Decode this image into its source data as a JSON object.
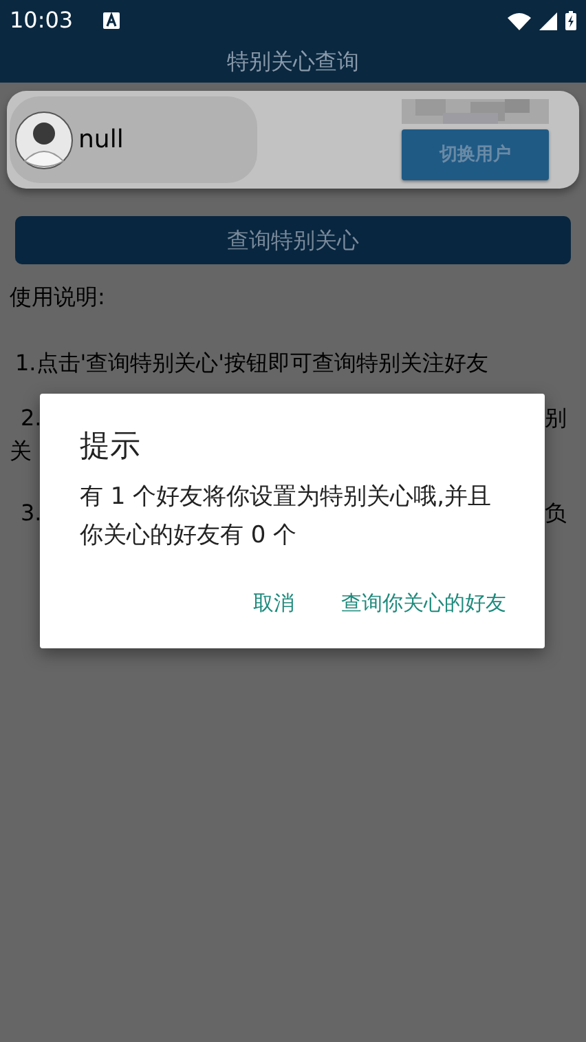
{
  "status_bar": {
    "time": "10:03"
  },
  "app_bar": {
    "title": "特别关心查询"
  },
  "user_card": {
    "name": "null",
    "switch_button": "切换用户"
  },
  "query_button": "查询特别关心",
  "instructions": {
    "heading": "使用说明:",
    "item_1": "1.点击'查询特别关心'按钮即可查询特别关注好友",
    "item_2_fragments": [
      {
        "kind": "start",
        "text": "2."
      },
      {
        "kind": "end",
        "text": "别"
      },
      {
        "kind": "wrap",
        "text": "关"
      }
    ],
    "item_3_fragments": [
      {
        "kind": "start",
        "text": "3."
      },
      {
        "kind": "end",
        "text": "负"
      }
    ]
  },
  "dialog": {
    "title": "提示",
    "message": "有 1 个好友将你设置为特别关心哦,并且你关心的好友有 0 个",
    "buttons": [
      "取消",
      "查询你关心的好友"
    ]
  }
}
